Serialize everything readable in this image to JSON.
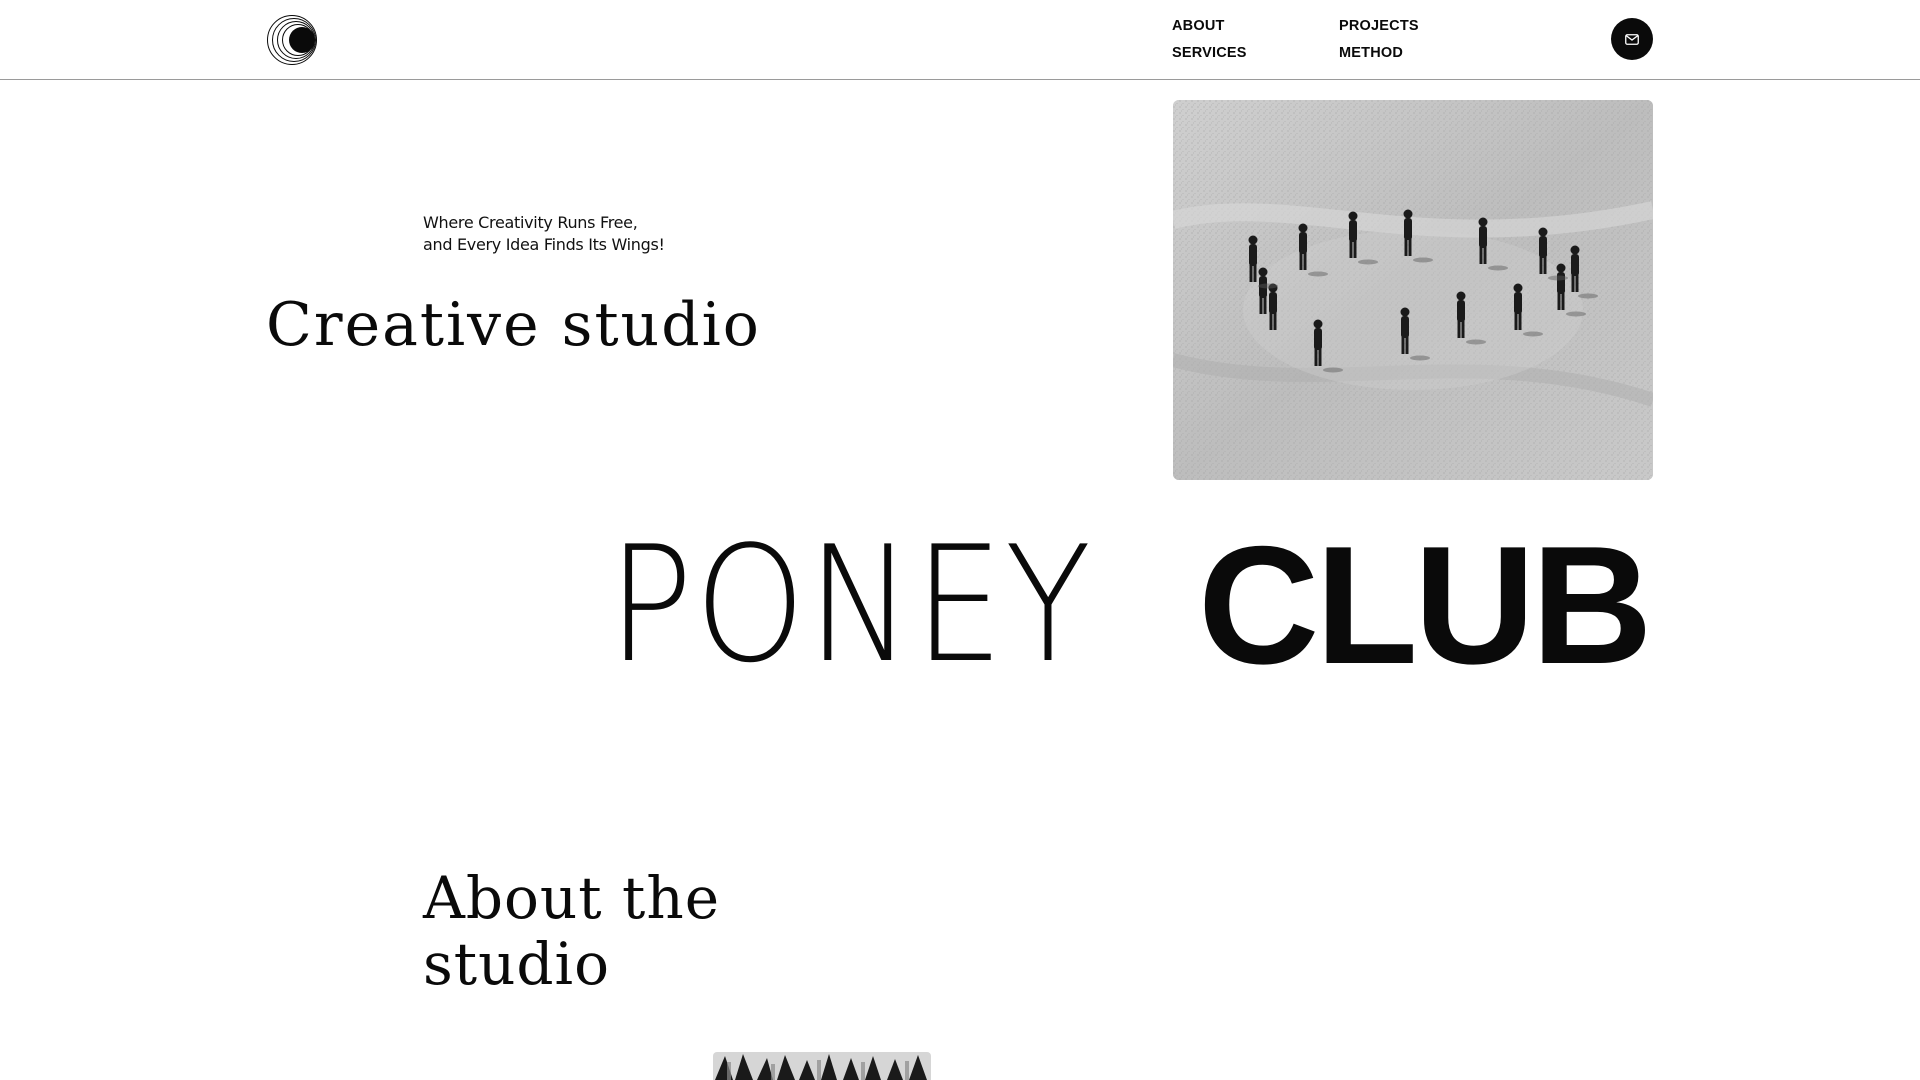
{
  "header": {
    "logo_icon": "concentric-circles-logo",
    "nav": [
      {
        "label": "ABOUT"
      },
      {
        "label": "PROJECTS"
      },
      {
        "label": "SERVICES"
      },
      {
        "label": "METHOD"
      }
    ],
    "contact_icon": "mail-icon"
  },
  "hero": {
    "tagline_line1": "Where Creativity Runs Free,",
    "tagline_line2": "and Every Idea Finds Its Wings!",
    "title": "Creative studio",
    "image_subject": "group-in-circle-on-sand-photo"
  },
  "wordmark": {
    "light": "PONEY",
    "bold": "CLUB"
  },
  "about": {
    "title_line1": "About the",
    "title_line2": "studio",
    "thumb_subject": "patterned-thumbnail"
  },
  "colors": {
    "ink": "#0a0a0a",
    "background": "#ffffff",
    "divider": "#9a9a9a"
  }
}
